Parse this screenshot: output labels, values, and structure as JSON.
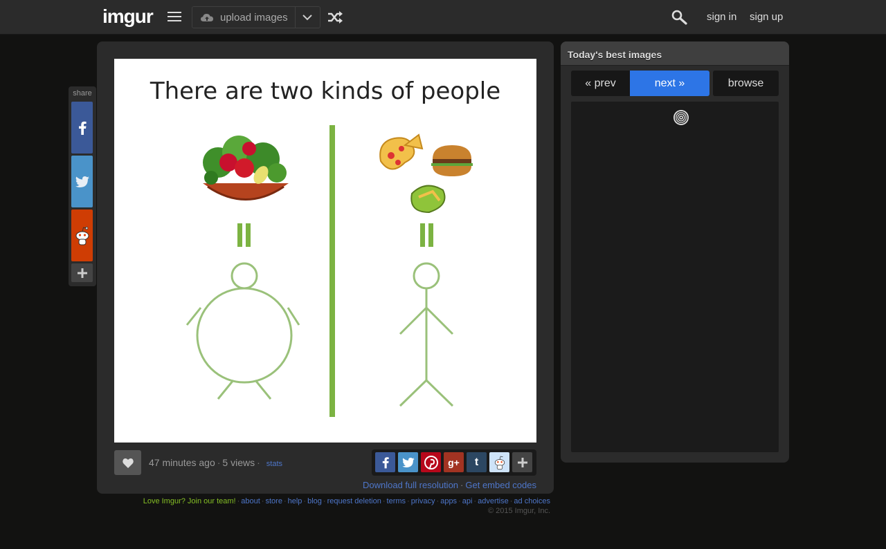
{
  "header": {
    "logo_text": "imgur",
    "upload_label": "upload images",
    "sign_in": "sign in",
    "sign_up": "sign up",
    "icons": [
      "menu-icon",
      "cloud-upload-icon",
      "chevron-down-icon",
      "random-shuffle-icon",
      "search-icon"
    ]
  },
  "share_sidebar": {
    "label": "share",
    "buttons": [
      "facebook",
      "twitter",
      "reddit",
      "more"
    ]
  },
  "image": {
    "heading": "There are two kinds of people",
    "age": "47 minutes ago",
    "views": "5 views",
    "stats_label": "stats",
    "download_label": "Download full resolution",
    "embed_label": "Get embed codes",
    "share_icons": [
      "facebook",
      "twitter",
      "pinterest",
      "google-plus",
      "tumblr",
      "reddit",
      "more"
    ]
  },
  "side": {
    "title": "Today's best images",
    "prev": "« prev",
    "next": "next »",
    "browse": "browse"
  },
  "footer": {
    "join": "Love Imgur? Join our team!",
    "links": [
      "about",
      "store",
      "help",
      "blog",
      "request deletion",
      "terms",
      "privacy",
      "apps",
      "api",
      "advertise",
      "ad choices"
    ],
    "copyright": "© 2015 Imgur, Inc."
  },
  "colors": {
    "accent_blue": "#2d75e6",
    "brand_green": "#85bf25",
    "link_blue": "#4e76c9",
    "panel_bg": "#2b2b2b",
    "page_bg": "#121211"
  }
}
